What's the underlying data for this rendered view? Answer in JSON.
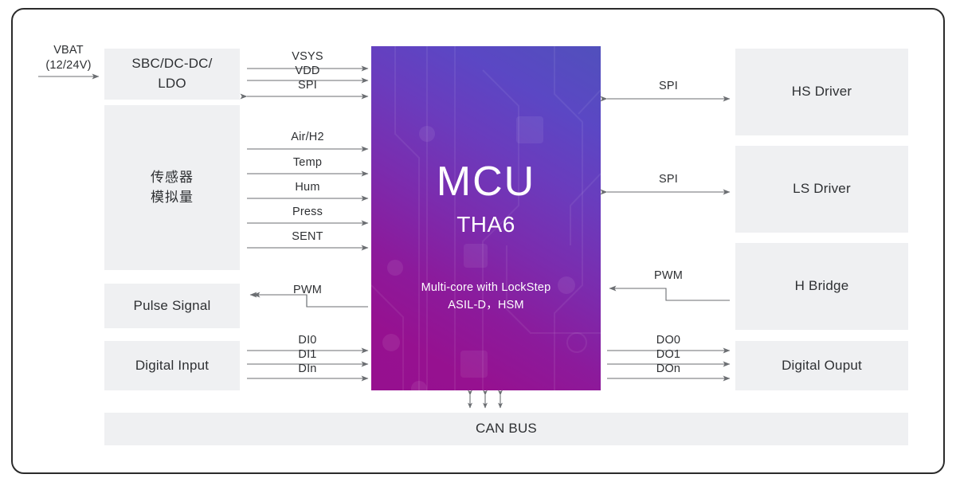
{
  "title": "MCU THA6 Automotive System Block Diagram",
  "colors": {
    "box_fill": "#eff0f2",
    "frame_border": "#2b2b2b",
    "line": "#6b6e72",
    "text": "#2e3033",
    "mcu_gradient_start": "#96108f",
    "mcu_gradient_end": "#5150bc"
  },
  "mcu": {
    "title": "MCU",
    "subtitle": "THA6",
    "note_line1": "Multi-core  with LockStep",
    "note_line2": "ASIL-D，HSM"
  },
  "power_input": {
    "label_line1": "VBAT",
    "label_line2": "(12/24V)"
  },
  "left_blocks": [
    {
      "name": "sbc-dc-dc-ldo",
      "label_line1": "SBC/DC-DC/",
      "label_line2": "LDO"
    },
    {
      "name": "sensor-analog",
      "label_line1": "传感器",
      "label_line2": "模拟量"
    },
    {
      "name": "pulse-signal",
      "label_line1": "Pulse Signal",
      "label_line2": ""
    },
    {
      "name": "digital-input",
      "label_line1": "Digital Input",
      "label_line2": ""
    }
  ],
  "right_blocks": [
    {
      "name": "hs-driver",
      "label": "HS Driver"
    },
    {
      "name": "ls-driver",
      "label": "LS Driver"
    },
    {
      "name": "h-bridge",
      "label": "H Bridge"
    },
    {
      "name": "digital-output",
      "label": "Digital Ouput"
    }
  ],
  "bottom_block": {
    "name": "can-bus",
    "label": "CAN  BUS"
  },
  "left_signals": [
    {
      "label": "VSYS",
      "direction": "to-mcu"
    },
    {
      "label": "VDD",
      "direction": "to-mcu"
    },
    {
      "label": "SPI",
      "direction": "bidirectional"
    },
    {
      "label": "Air/H2",
      "direction": "to-mcu"
    },
    {
      "label": "Temp",
      "direction": "to-mcu"
    },
    {
      "label": "Hum",
      "direction": "to-mcu"
    },
    {
      "label": "Press",
      "direction": "to-mcu"
    },
    {
      "label": "SENT",
      "direction": "to-mcu"
    },
    {
      "label": "PWM",
      "direction": "stepped-bidirectional"
    },
    {
      "label": "DI0",
      "direction": "to-mcu"
    },
    {
      "label": "DI1",
      "direction": "to-mcu"
    },
    {
      "label": "DIn",
      "direction": "to-mcu"
    }
  ],
  "right_signals": [
    {
      "label": "SPI",
      "direction": "bidirectional"
    },
    {
      "label": "SPI",
      "direction": "bidirectional"
    },
    {
      "label": "PWM",
      "direction": "stepped-bidirectional"
    },
    {
      "label": "DO0",
      "direction": "from-mcu"
    },
    {
      "label": "DO1",
      "direction": "from-mcu"
    },
    {
      "label": "DOn",
      "direction": "from-mcu"
    }
  ],
  "can_arrows": {
    "count": 3,
    "direction": "bidirectional-vertical"
  }
}
